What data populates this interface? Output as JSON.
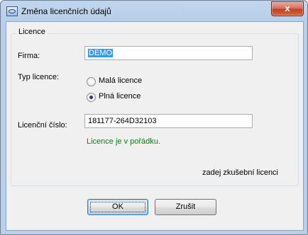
{
  "window": {
    "title": "Změna licenčních údajů",
    "close_glyph": "x"
  },
  "group": {
    "title": "Licence"
  },
  "firma": {
    "label": "Firma:",
    "value": "DEMO"
  },
  "typ_licence": {
    "label": "Typ licence:",
    "options": [
      {
        "label": "Malá licence",
        "checked": false
      },
      {
        "label": "Plná licence",
        "checked": true
      }
    ]
  },
  "licencni_cislo": {
    "label": "Licenční číslo:",
    "value": "181177-264D32103"
  },
  "status_text": "Licence je v pořádku.",
  "trial_link": "zadej zkušební licenci",
  "buttons": {
    "ok": "OK",
    "cancel": "Zrušit"
  },
  "colors": {
    "status": "#0b7d18",
    "selection": "#3399ff"
  }
}
